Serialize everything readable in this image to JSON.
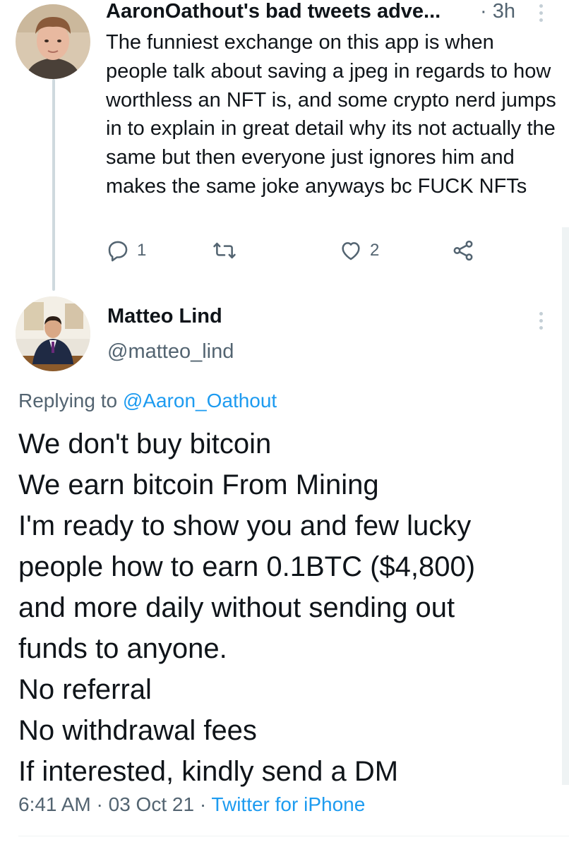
{
  "tweet1": {
    "display_name": "AaronOathout's bad tweets adve...",
    "time": "· 3h",
    "text": "The funniest exchange on this app is when people talk about saving a jpeg in regards to how worthless an NFT is, and some crypto nerd jumps in to explain in great detail why its not actually the same but then everyone just ignores him and makes the same joke anyways bc FUCK NFTs",
    "actions": {
      "reply_count": "1",
      "retweet_count": "",
      "like_count": "2"
    }
  },
  "tweet2": {
    "display_name": "Matteo Lind",
    "handle": "@matteo_lind",
    "replying_prefix": "Replying to",
    "replying_to": "@Aaron_Oathout",
    "lines": [
      "We don't  buy bitcoin",
      "We earn bitcoin From Mining",
      "I'm ready to show you and few lucky",
      "people how to earn 0.1BTC ($4,800)",
      "and more daily without sending out",
      "funds to anyone.",
      "No referral",
      "No withdrawal fees",
      "If interested, kindly send a DM"
    ],
    "time": "6:41 AM",
    "sep1": "·",
    "date": "03 Oct 21",
    "sep2": "·",
    "source": "Twitter for iPhone"
  },
  "colors": {
    "accent": "#1d9bf0",
    "text": "#0f1419",
    "secondary": "#536471",
    "divider": "#eff3f4"
  },
  "icons": {
    "reply": "reply-icon",
    "retweet": "retweet-icon",
    "like": "heart-icon",
    "share": "share-icon",
    "more": "more-icon"
  }
}
